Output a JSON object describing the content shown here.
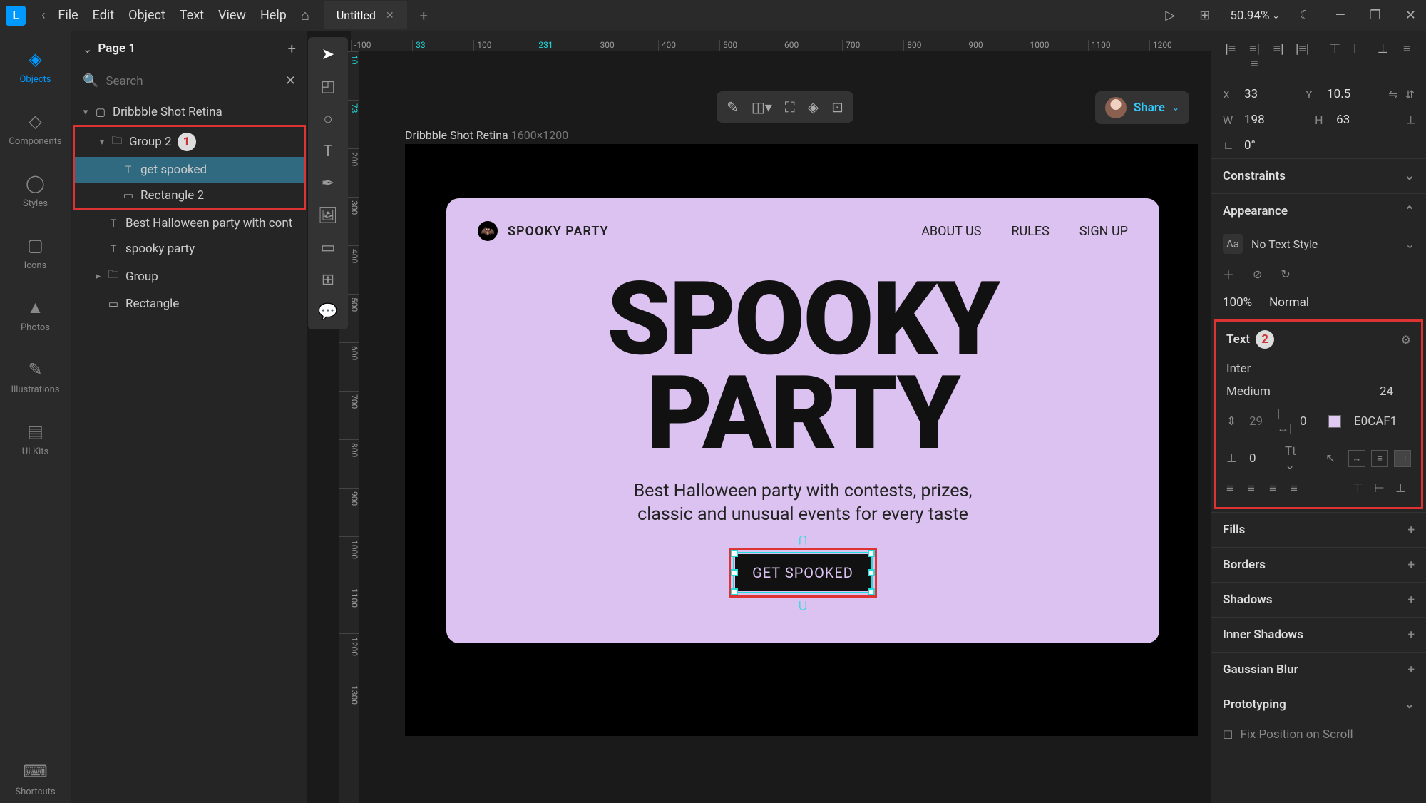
{
  "titlebar": {
    "menu": [
      "File",
      "Edit",
      "Object",
      "Text",
      "View",
      "Help"
    ],
    "tab": "Untitled",
    "zoom": "50.94%"
  },
  "rail": [
    {
      "icon": "◈",
      "label": "Objects",
      "active": true
    },
    {
      "icon": "◇",
      "label": "Components"
    },
    {
      "icon": "◯",
      "label": "Styles"
    },
    {
      "icon": "▢",
      "label": "Icons"
    },
    {
      "icon": "▲",
      "label": "Photos"
    },
    {
      "icon": "✎",
      "label": "Illustrations"
    },
    {
      "icon": "▤",
      "label": "UI Kits"
    }
  ],
  "rail_footer": {
    "icon": "⌨",
    "label": "Shortcuts"
  },
  "page_header": "Page 1",
  "search_placeholder": "Search",
  "layers": {
    "frame": "Dribbble Shot Retina",
    "group2": "Group 2",
    "get_spooked": "get spooked",
    "rect2": "Rectangle 2",
    "best_text": "Best Halloween party with cont",
    "spooky_text": "spooky party",
    "group": "Group",
    "rect": "Rectangle"
  },
  "ruler_h": [
    "-100",
    "33",
    "100",
    "231",
    "300",
    "400",
    "500",
    "600",
    "700",
    "800",
    "900",
    "1000",
    "1100",
    "1200"
  ],
  "ruler_v": [
    "10",
    "73",
    "200",
    "300",
    "400",
    "500",
    "600",
    "700",
    "800",
    "900",
    "1000",
    "1100",
    "1200",
    "1300"
  ],
  "canvas": {
    "frame_name": "Dribbble Shot Retina",
    "frame_dim": "1600×1200",
    "brand": "SPOOKY PARTY",
    "nav": [
      "ABOUT US",
      "RULES",
      "SIGN UP"
    ],
    "hero_l1": "SPOOKY",
    "hero_l2": "PARTY",
    "sub_l1": "Best Halloween party with contests, prizes,",
    "sub_l2": "classic and unusual events for every taste",
    "cta": "GET SPOOKED"
  },
  "share": "Share",
  "right": {
    "x": "33",
    "y": "10.5",
    "w": "198",
    "h": "63",
    "angle": "0°",
    "constraints": "Constraints",
    "appearance": "Appearance",
    "no_text_style": "No Text Style",
    "opacity": "100%",
    "blend": "Normal",
    "text_section": "Text",
    "font": "Inter",
    "weight": "Medium",
    "size": "24",
    "line_h": "29",
    "letter": "0",
    "color": "E0CAF1",
    "para": "0",
    "fills": "Fills",
    "borders": "Borders",
    "shadows": "Shadows",
    "inner_shadows": "Inner Shadows",
    "blur": "Gaussian Blur",
    "proto": "Prototyping",
    "fix_scroll": "Fix Position on Scroll"
  },
  "callouts": {
    "c1": "1",
    "c2": "2"
  }
}
